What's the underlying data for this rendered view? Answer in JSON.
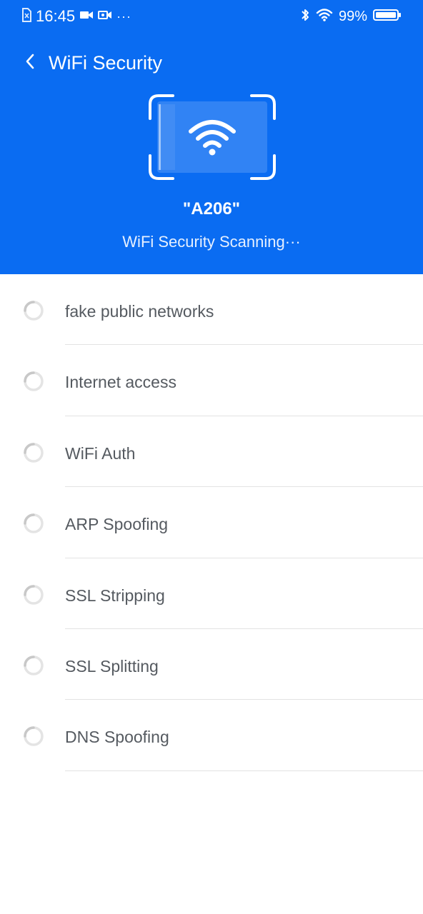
{
  "status_bar": {
    "time": "16:45",
    "battery_percent": "99%",
    "overflow_dots": "···"
  },
  "nav": {
    "title": "WiFi Security"
  },
  "scan": {
    "network_name": "\"A206\"",
    "status_text": "WiFi Security Scanning···"
  },
  "checks": [
    {
      "label": "fake public networks"
    },
    {
      "label": "Internet access"
    },
    {
      "label": "WiFi Auth"
    },
    {
      "label": "ARP Spoofing"
    },
    {
      "label": "SSL Stripping"
    },
    {
      "label": "SSL Splitting"
    },
    {
      "label": "DNS Spoofing"
    }
  ],
  "colors": {
    "header_blue": "#0a6cf2",
    "text_gray": "#555a60",
    "divider": "#e3e3e3"
  }
}
